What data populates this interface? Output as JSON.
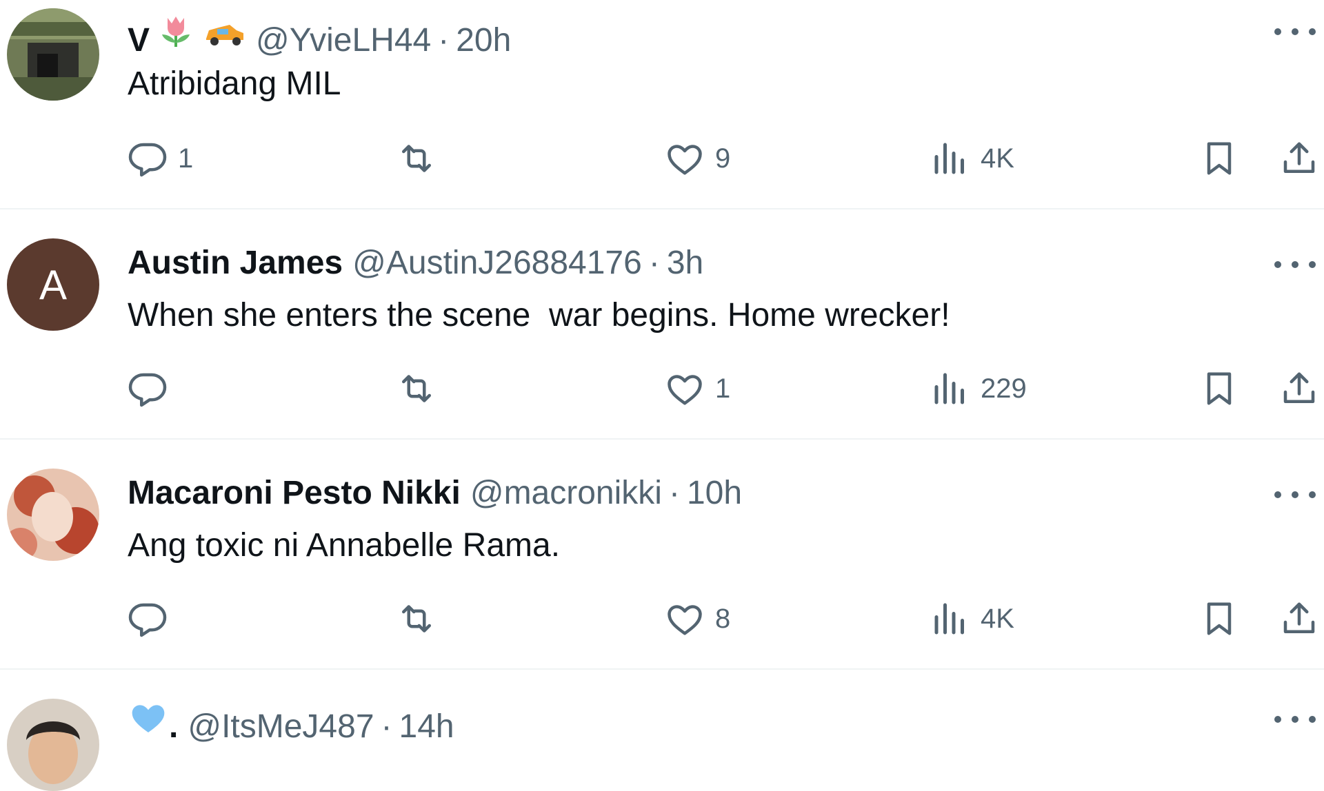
{
  "tweets": [
    {
      "name": "V",
      "name_emojis": [
        "tulip-emoji",
        "race-car-emoji"
      ],
      "handle": "@YvieLH44",
      "separator": "·",
      "time": "20h",
      "text": "Atribidang MIL",
      "reply_count": "1",
      "retweet_count": "",
      "like_count": "9",
      "view_count": "4K"
    },
    {
      "name": "Austin James",
      "avatar_letter": "A",
      "handle": "@AustinJ26884176",
      "separator": "·",
      "time": "3h",
      "text": "When she enters the scene  war begins. Home wrecker!",
      "reply_count": "",
      "retweet_count": "",
      "like_count": "1",
      "view_count": "229"
    },
    {
      "name": "Macaroni Pesto Nikki",
      "handle": "@macronikki",
      "separator": "·",
      "time": "10h",
      "text": "Ang toxic ni Annabelle Rama.",
      "reply_count": "",
      "retweet_count": "",
      "like_count": "8",
      "view_count": "4K"
    },
    {
      "name": ".",
      "name_emojis": [
        "blue-heart-emoji"
      ],
      "handle": "@ItsMeJ487",
      "separator": "·",
      "time": "14h"
    }
  ],
  "colors": {
    "text": "#0f1419",
    "secondary": "#536471",
    "divider": "#eff3f4",
    "avatar_letter_bg": "#5b3a2e",
    "blue_heart": "#7cc1f5"
  }
}
